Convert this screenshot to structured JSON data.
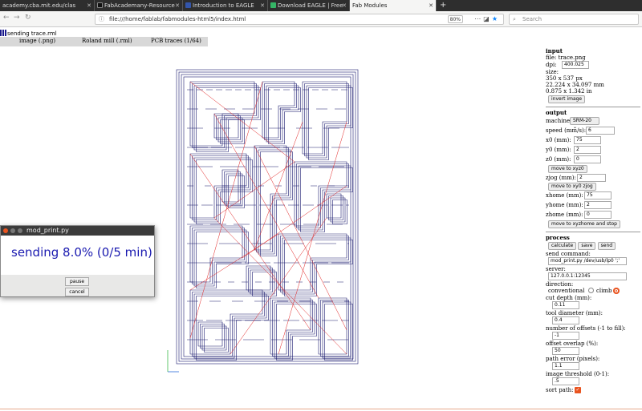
{
  "browser": {
    "tabs": [
      {
        "title": "academy.cba.mit.edu/clas",
        "icon_color": "#888888",
        "active": false
      },
      {
        "title": "FabAcademany-Resource",
        "icon_color": "#1c1c1c",
        "active": false
      },
      {
        "title": "Introduction to EAGLE",
        "icon_color": "#3355aa",
        "active": false
      },
      {
        "title": "Download EAGLE | Free",
        "icon_color": "#35b566",
        "active": false
      },
      {
        "title": "Fab Modules",
        "icon_color": "#f5f5f4",
        "active": true
      }
    ],
    "new_tab": "+",
    "url": "file:///home/fablab/fabmodules-html5/index.html",
    "zoom": "80%",
    "search_placeholder": "Search"
  },
  "page": {
    "status": "sending trace.rml",
    "panel_tabs": [
      "image (.png)",
      "Roland mill (.rml)",
      "PCB traces (1/64)"
    ]
  },
  "input": {
    "heading": "input",
    "file": "file: trace.png",
    "dpi_label": "dpi:",
    "dpi_value": "400.025",
    "size_label": "size:",
    "size_px": "350 x 537 px",
    "size_mm": "22.224 x 34.097 mm",
    "size_in": "0.875 x 1.342 in",
    "invert_button": "invert image"
  },
  "output": {
    "heading": "output",
    "machine_label": "machine",
    "machine_value": "SRM-20",
    "speed_label": "speed (mm/s):",
    "speed_value": "6",
    "x0_label": "x0 (mm):",
    "x0_value": "75",
    "y0_label": "y0 (mm):",
    "y0_value": "2",
    "z0_label": "z0 (mm):",
    "z0_value": "0",
    "move_xyz0": "move to xyz0",
    "zjog_label": "zjog (mm):",
    "zjog_value": "2",
    "move_xy0": "move to xy0 zjog",
    "xhome_label": "xhome (mm):",
    "xhome_value": "75",
    "yhome_label": "yhome (mm):",
    "yhome_value": "2",
    "zhome_label": "zhome (mm):",
    "zhome_value": "0",
    "move_home": "move to xyzhome and stop"
  },
  "process": {
    "heading": "process",
    "calculate": "calculate",
    "save": "save",
    "send": "send",
    "send_command_label": "send command:",
    "send_command_value": "mod_print.py /dev/usb/lp0 ';'",
    "server_label": "server:",
    "server_value": "127.0.0.1:12345",
    "direction_label": "direction:",
    "conventional": "conventional",
    "climb": "climb",
    "cut_depth_label": "cut depth (mm):",
    "cut_depth_value": "0.11",
    "tool_diameter_label": "tool diameter (mm):",
    "tool_diameter_value": "0.4",
    "offsets_label": "number of offsets (-1 to fill):",
    "offsets_value": "-1",
    "overlap_label": "offset overlap (%):",
    "overlap_value": "50",
    "path_error_label": "path error (pixels):",
    "path_error_value": "1.1",
    "threshold_label": "image threshold (0-1):",
    "threshold_value": ".5",
    "sort_label": "sort path:"
  },
  "dialog": {
    "title": "mod_print.py",
    "message": "sending 8.0% (0/5 min)",
    "pause": "pause",
    "cancel": "cancel"
  },
  "colors": {
    "trace": "#1a1a6e",
    "rapid": "#e02020",
    "accent": "#e95420"
  }
}
